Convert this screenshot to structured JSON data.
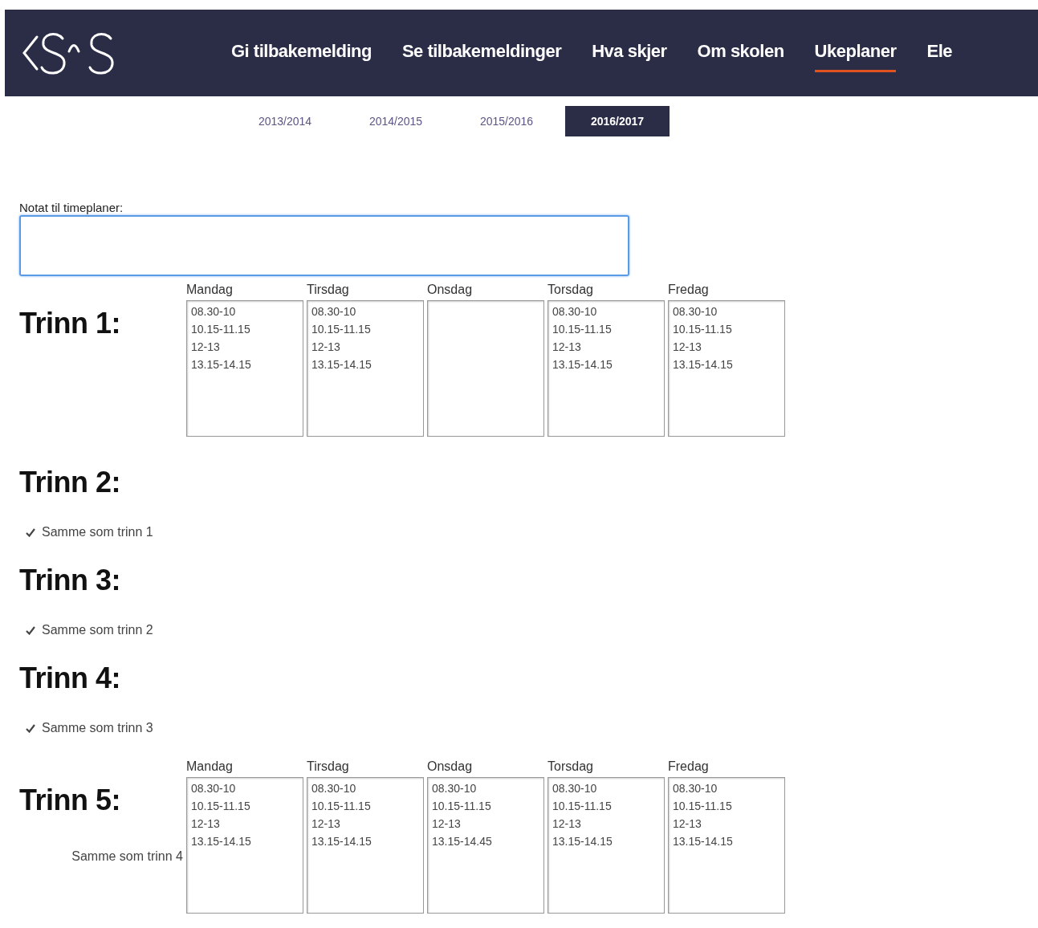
{
  "nav": {
    "items": [
      {
        "label": "Gi tilbakemelding",
        "selected": false
      },
      {
        "label": "Se tilbakemeldinger",
        "selected": false
      },
      {
        "label": "Hva skjer",
        "selected": false
      },
      {
        "label": "Om skolen",
        "selected": false
      },
      {
        "label": "Ukeplaner",
        "selected": true
      },
      {
        "label": "Ele",
        "selected": false
      }
    ]
  },
  "years": [
    {
      "label": "2013/2014",
      "selected": false
    },
    {
      "label": "2014/2015",
      "selected": false
    },
    {
      "label": "2015/2016",
      "selected": false
    },
    {
      "label": "2016/2017",
      "selected": true
    }
  ],
  "note": {
    "label": "Notat til timeplaner:"
  },
  "grades": [
    {
      "title": "Trinn 1:",
      "kind": "schedule",
      "days": [
        {
          "label": "Mandag",
          "text": "08.30-10\n10.15-11.15\n12-13\n13.15-14.15"
        },
        {
          "label": "Tirsdag",
          "text": "08.30-10\n10.15-11.15\n12-13\n13.15-14.15"
        },
        {
          "label": "Onsdag"
        },
        {
          "label": "Torsdag",
          "text": "08.30-10\n10.15-11.15\n12-13\n13.15-14.15"
        },
        {
          "label": "Fredag",
          "text": "08.30-10\n10.15-11.15\n12-13\n13.15-14.15"
        }
      ]
    },
    {
      "title": "Trinn 2:",
      "kind": "copy",
      "same": {
        "label": "Samme som trinn 1",
        "checked": true
      }
    },
    {
      "title": "Trinn 3:",
      "kind": "copy",
      "same": {
        "label": "Samme som trinn 2",
        "checked": true
      }
    },
    {
      "title": "Trinn 4:",
      "kind": "copy",
      "same": {
        "label": "Samme som trinn 3",
        "checked": true
      }
    },
    {
      "title": "Trinn 5:",
      "kind": "schedule",
      "same": {
        "label": "Samme som trinn 4",
        "checked": false
      },
      "days": [
        {
          "label": "Mandag",
          "text": "08.30-10\n10.15-11.15\n12-13\n13.15-14.15"
        },
        {
          "label": "Tirsdag",
          "text": "08.30-10\n10.15-11.15\n12-13\n13.15-14.15"
        },
        {
          "label": "Onsdag",
          "text": "08.30-10\n10.15-11.15\n12-13\n13.15-14.45"
        },
        {
          "label": "Torsdag",
          "text": "08.30-10\n10.15-11.15\n12-13\n13.15-14.15"
        },
        {
          "label": "Fredag",
          "text": "08.30-10\n10.15-11.15\n12-13\n13.15-14.15"
        }
      ]
    }
  ]
}
